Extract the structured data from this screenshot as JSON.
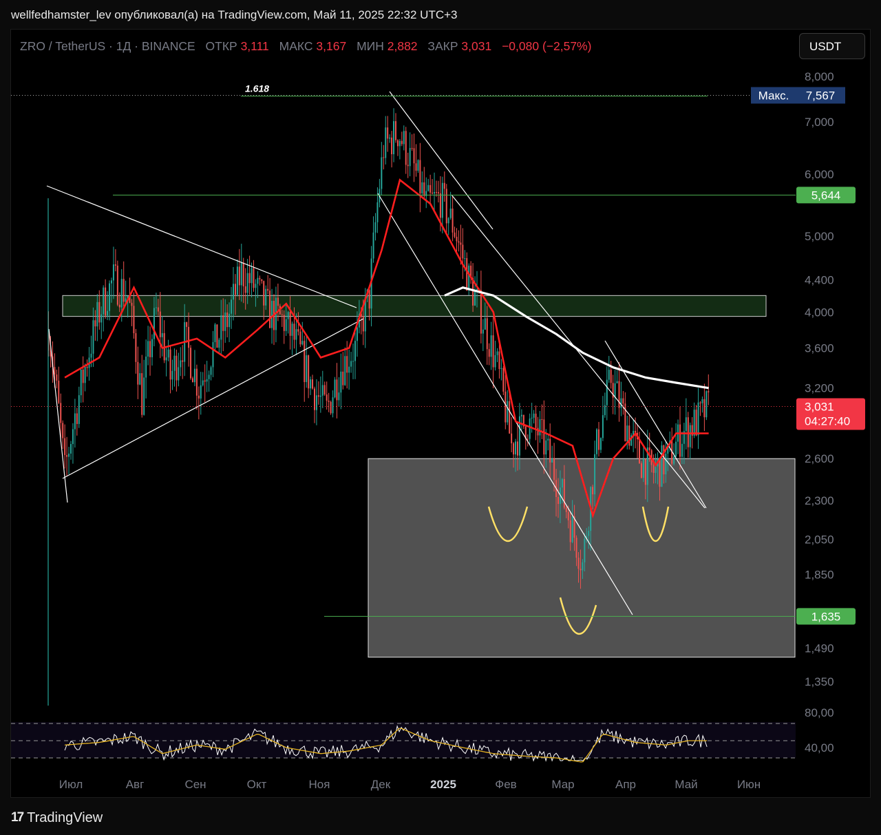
{
  "header": {
    "text": "wellfedhamster_lev опубликовал(а) на TradingView.com, Май 11, 2025 22:32 UTC+3"
  },
  "legend": {
    "symbol": "ZRO / TetherUS · 1Д · BINANCE",
    "open_label": "ОТКР",
    "open": "3,111",
    "high_label": "МАКС",
    "high": "3,167",
    "low_label": "МИН",
    "low": "2,882",
    "close_label": "ЗАКР",
    "close": "3,031",
    "change": "−0,080 (−2,57%)"
  },
  "currency_button": "USDT",
  "footer": {
    "logo": "TradingView",
    "logo_icon": "tradingview-logo-icon"
  },
  "colors": {
    "up": "#26a69a",
    "down": "#ef5350",
    "accent_red": "#f23645",
    "label_green": "#4caf50",
    "max_label_bg": "#1e3a6e",
    "ma_red": "#ff1e1e",
    "ma_white": "#ffffff"
  },
  "chart_data": {
    "type": "line",
    "title": "",
    "price_axis": {
      "scale": "log",
      "ticks": [
        "8,000",
        "7,000",
        "6,000",
        "5,000",
        "4,400",
        "4,000",
        "3,600",
        "3,200",
        "2,600",
        "2,300",
        "2,050",
        "1,850",
        "1,490",
        "1,350"
      ]
    },
    "time_axis": {
      "ticks": [
        "Июл",
        "Авг",
        "Сен",
        "Окт",
        "Ноя",
        "Дек",
        "2025",
        "Фев",
        "Мар",
        "Апр",
        "Май",
        "Июн"
      ]
    },
    "price_series": {
      "name": "",
      "x": [
        "2024-06-20",
        "2024-06-28",
        "2024-07-08",
        "2024-07-15",
        "2024-07-22",
        "2024-07-29",
        "2024-08-05",
        "2024-08-12",
        "2024-08-19",
        "2024-08-26",
        "2024-09-02",
        "2024-09-09",
        "2024-09-16",
        "2024-09-23",
        "2024-09-30",
        "2024-10-07",
        "2024-10-14",
        "2024-10-21",
        "2024-10-28",
        "2024-11-04",
        "2024-11-11",
        "2024-11-18",
        "2024-11-25",
        "2024-12-02",
        "2024-12-09",
        "2024-12-16",
        "2024-12-23",
        "2024-12-30",
        "2025-01-06",
        "2025-01-13",
        "2025-01-20",
        "2025-01-27",
        "2025-02-03",
        "2025-02-10",
        "2025-02-17",
        "2025-02-24",
        "2025-03-03",
        "2025-03-10",
        "2025-03-17",
        "2025-03-24",
        "2025-03-31",
        "2025-04-07",
        "2025-04-14",
        "2025-04-21",
        "2025-04-28",
        "2025-05-05",
        "2025-05-11"
      ],
      "y": [
        3.8,
        2.5,
        3.4,
        4.0,
        4.4,
        4.2,
        3.1,
        4.0,
        3.3,
        3.7,
        3.2,
        3.6,
        3.9,
        4.5,
        4.3,
        4.0,
        3.9,
        3.6,
        3.2,
        3.0,
        3.4,
        3.6,
        4.2,
        6.5,
        6.8,
        6.2,
        5.5,
        5.6,
        5.1,
        4.4,
        3.9,
        3.4,
        2.7,
        2.9,
        2.8,
        2.5,
        2.2,
        1.9,
        2.7,
        3.3,
        2.9,
        2.6,
        2.5,
        2.6,
        2.8,
        2.9,
        3.031
      ]
    },
    "ma_short": {
      "name": "",
      "x": [
        "2024-06-28",
        "2024-07-15",
        "2024-08-01",
        "2024-08-15",
        "2024-09-01",
        "2024-09-15",
        "2024-10-01",
        "2024-10-15",
        "2024-11-01",
        "2024-11-15",
        "2024-12-01",
        "2024-12-10",
        "2024-12-25",
        "2025-01-10",
        "2025-01-25",
        "2025-02-05",
        "2025-02-20",
        "2025-03-05",
        "2025-03-15",
        "2025-03-25",
        "2025-04-05",
        "2025-04-15",
        "2025-04-25",
        "2025-05-11"
      ],
      "y": [
        3.3,
        3.5,
        4.3,
        3.6,
        3.7,
        3.5,
        3.8,
        4.1,
        3.5,
        3.6,
        4.8,
        5.9,
        5.5,
        4.6,
        4.0,
        2.9,
        2.8,
        2.7,
        2.2,
        2.6,
        2.8,
        2.55,
        2.8,
        2.8
      ]
    },
    "ma_long": {
      "name": "",
      "x": [
        "2025-01-01",
        "2025-01-10",
        "2025-01-25",
        "2025-02-10",
        "2025-02-25",
        "2025-03-10",
        "2025-03-25",
        "2025-04-10",
        "2025-04-25",
        "2025-05-11"
      ],
      "y": [
        4.2,
        4.3,
        4.2,
        3.95,
        3.75,
        3.55,
        3.4,
        3.3,
        3.25,
        3.2
      ]
    },
    "levels": [
      {
        "label": "1.618",
        "price": 7.55
      },
      {
        "label": "5,644",
        "price": 5.644
      },
      {
        "label": "1,635",
        "price": 1.635
      }
    ],
    "max_marker": {
      "label": "Макс.",
      "value": "7,567"
    },
    "last_price": {
      "value": "3,031",
      "countdown": "04:27:40"
    },
    "zones": [
      {
        "name": "resistance-zone",
        "price_top": 4.2,
        "price_bottom": 3.95
      },
      {
        "name": "demand-zone",
        "price_top": 2.6,
        "price_bottom": 1.45
      }
    ],
    "rsi": {
      "ticks": [
        "80,00",
        "40,00"
      ],
      "x": [
        "2024-06-28",
        "2024-07-15",
        "2024-08-01",
        "2024-08-15",
        "2024-09-01",
        "2024-09-15",
        "2024-10-01",
        "2024-10-15",
        "2024-11-01",
        "2024-11-15",
        "2024-12-01",
        "2024-12-10",
        "2024-12-25",
        "2025-01-10",
        "2025-01-25",
        "2025-02-10",
        "2025-02-25",
        "2025-03-10",
        "2025-03-20",
        "2025-04-05",
        "2025-04-20",
        "2025-05-01",
        "2025-05-11"
      ],
      "y": [
        55,
        58,
        65,
        45,
        55,
        50,
        68,
        52,
        45,
        48,
        55,
        75,
        60,
        52,
        45,
        42,
        40,
        35,
        68,
        58,
        55,
        60,
        60
      ]
    }
  }
}
